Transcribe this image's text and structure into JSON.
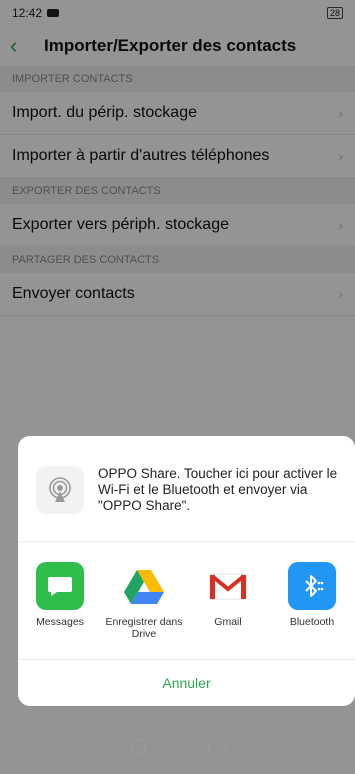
{
  "statusbar": {
    "time": "12:42",
    "battery": "28"
  },
  "header": {
    "title": "Importer/Exporter des contacts"
  },
  "sections": [
    {
      "title": "IMPORTER CONTACTS",
      "items": [
        "Import. du périp. stockage",
        "Importer à partir d'autres téléphones"
      ]
    },
    {
      "title": "EXPORTER DES CONTACTS",
      "items": [
        "Exporter vers périph. stockage"
      ]
    },
    {
      "title": "PARTAGER DES CONTACTS",
      "items": [
        "Envoyer contacts"
      ]
    }
  ],
  "share_sheet": {
    "oppo_text": "OPPO Share. Toucher ici pour activer le Wi-Fi et le Bluetooth et envoyer via \"OPPO Share\".",
    "apps": [
      {
        "label": "Messages",
        "icon": "messages-icon"
      },
      {
        "label": "Enregistrer dans Drive",
        "icon": "drive-icon"
      },
      {
        "label": "Gmail",
        "icon": "gmail-icon"
      },
      {
        "label": "Bluetooth",
        "icon": "bluetooth-icon"
      }
    ],
    "cancel": "Annuler"
  },
  "colors": {
    "accent": "#2fa84f",
    "overlay": "rgba(0,0,0,0.42)"
  }
}
